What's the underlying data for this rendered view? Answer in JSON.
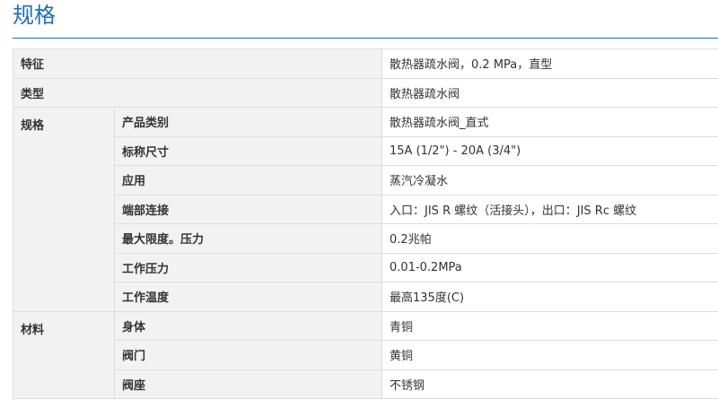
{
  "page": {
    "title": "规格"
  },
  "spec": {
    "feature": {
      "label": "特征",
      "value": "散热器疏水阀，0.2 MPa，直型"
    },
    "type": {
      "label": "类型",
      "value": "散热器疏水阀"
    },
    "specs": {
      "label": "规格",
      "rows": [
        {
          "label": "产品类别",
          "value": "散热器疏水阀_直式"
        },
        {
          "label": "标称尺寸",
          "value": "15A (1/2\") - 20A (3/4\")"
        },
        {
          "label": "应用",
          "value": "蒸汽冷凝水"
        },
        {
          "label": "端部连接",
          "value": "入口：JIS R 螺纹（活接头），出口：JIS Rc 螺纹"
        },
        {
          "label": "最大限度。压力",
          "value": "0.2兆帕"
        },
        {
          "label": "工作压力",
          "value": "0.01-0.2MPa"
        },
        {
          "label": "工作温度",
          "value": "最高135度(C)"
        }
      ]
    },
    "materials": {
      "label": "材料",
      "rows": [
        {
          "label": "身体",
          "value": "青铜"
        },
        {
          "label": "阀门",
          "value": "黄铜"
        },
        {
          "label": "阀座",
          "value": "不锈钢"
        }
      ]
    }
  }
}
